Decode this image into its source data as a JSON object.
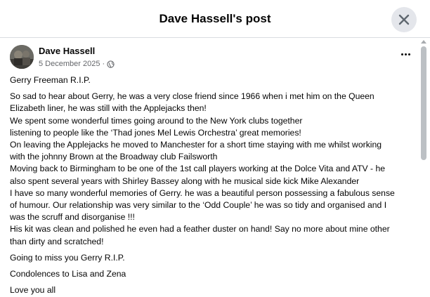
{
  "dialog": {
    "title": "Dave Hassell's post",
    "close_icon": "close-icon"
  },
  "post": {
    "author": "Dave Hassell",
    "date": "5 December 2025",
    "separator": "·",
    "privacy_icon": "globe-icon",
    "more_icon": "more-options-icon",
    "paragraphs": [
      [
        "Gerry Freeman R.I.P."
      ],
      [
        "So sad to hear about Gerry, he was a very close friend since 1966 when i met him on the Queen",
        "Elizabeth liner, he was still with the Applejacks then!",
        "We spent some wonderful times going around to the New York  clubs together",
        "listening to people like the ‘Thad jones Mel Lewis Orchestra’ great memories!",
        "On leaving the Applejacks he moved to Manchester for a short time staying with me whilst working",
        "with the johnny Brown at the Broadway club Failsworth",
        "Moving  back to Birmingham to be one of the 1st call players working at the Dolce Vita and ATV - he",
        "also spent several years with Shirley Bassey along with he musical side kick Mike Alexander",
        "I have so many wonderful memories of Gerry. he was a beautiful person possessing a fabulous sense",
        "of humour. Our relationship was very similar to the ‘Odd Couple’ he was so tidy and organised and I",
        "was the scruff and disorganise !!!",
        "His kit was clean and polished he even had a feather duster on hand!  Say no more about mine other",
        "than dirty and scratched!"
      ],
      [
        "Going to miss you Gerry R.I.P."
      ],
      [
        "Condolences to Lisa and Zena"
      ],
      [
        "Love you all"
      ]
    ]
  },
  "colors": {
    "text_primary": "#050505",
    "text_secondary": "#65676b",
    "divider": "#dadde1",
    "button_bg": "#e4e6eb"
  }
}
